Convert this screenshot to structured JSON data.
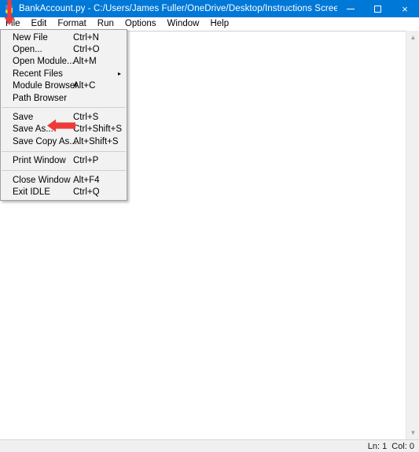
{
  "window": {
    "title": "BankAccount.py - C:/Users/James Fuller/OneDrive/Desktop/Instructions Screenshots/BankAc...",
    "app_icon": "python-file-icon",
    "minimize_label": "─",
    "maximize_label": "☐",
    "close_label": "×",
    "titlebar_color": "#0078d7"
  },
  "menubar": {
    "items": [
      {
        "label": "File",
        "active": true
      },
      {
        "label": "Edit",
        "active": false
      },
      {
        "label": "Format",
        "active": false
      },
      {
        "label": "Run",
        "active": false
      },
      {
        "label": "Options",
        "active": false
      },
      {
        "label": "Window",
        "active": false
      },
      {
        "label": "Help",
        "active": false
      }
    ]
  },
  "file_menu": {
    "items": [
      {
        "label": "New File",
        "accel": "Ctrl+N",
        "submenu": false
      },
      {
        "label": "Open...",
        "accel": "Ctrl+O",
        "submenu": false
      },
      {
        "label": "Open Module...",
        "accel": "Alt+M",
        "submenu": false
      },
      {
        "label": "Recent Files",
        "accel": "",
        "submenu": true,
        "submenu_arrow": "▸"
      },
      {
        "label": "Module Browser",
        "accel": "Alt+C",
        "submenu": false
      },
      {
        "label": "Path Browser",
        "accel": "",
        "submenu": false
      },
      {
        "separator": true
      },
      {
        "label": "Save",
        "accel": "Ctrl+S",
        "submenu": false
      },
      {
        "label": "Save As...",
        "accel": "Ctrl+Shift+S",
        "submenu": false
      },
      {
        "label": "Save Copy As...",
        "accel": "Alt+Shift+S",
        "submenu": false
      },
      {
        "separator": true
      },
      {
        "label": "Print Window",
        "accel": "Ctrl+P",
        "submenu": false
      },
      {
        "separator": true
      },
      {
        "label": "Close Window",
        "accel": "Alt+F4",
        "submenu": false
      },
      {
        "label": "Exit IDLE",
        "accel": "Ctrl+Q",
        "submenu": false
      }
    ]
  },
  "editor": {
    "content": "",
    "scrollbar": {
      "up_arrow": "▲",
      "down_arrow": "▼"
    }
  },
  "statusbar": {
    "line": "Ln: 1",
    "column": "Col: 0"
  },
  "annotations": {
    "color": "#ef3a3a",
    "arrow_down_target": "File",
    "arrow_left_target": "Save As..."
  }
}
